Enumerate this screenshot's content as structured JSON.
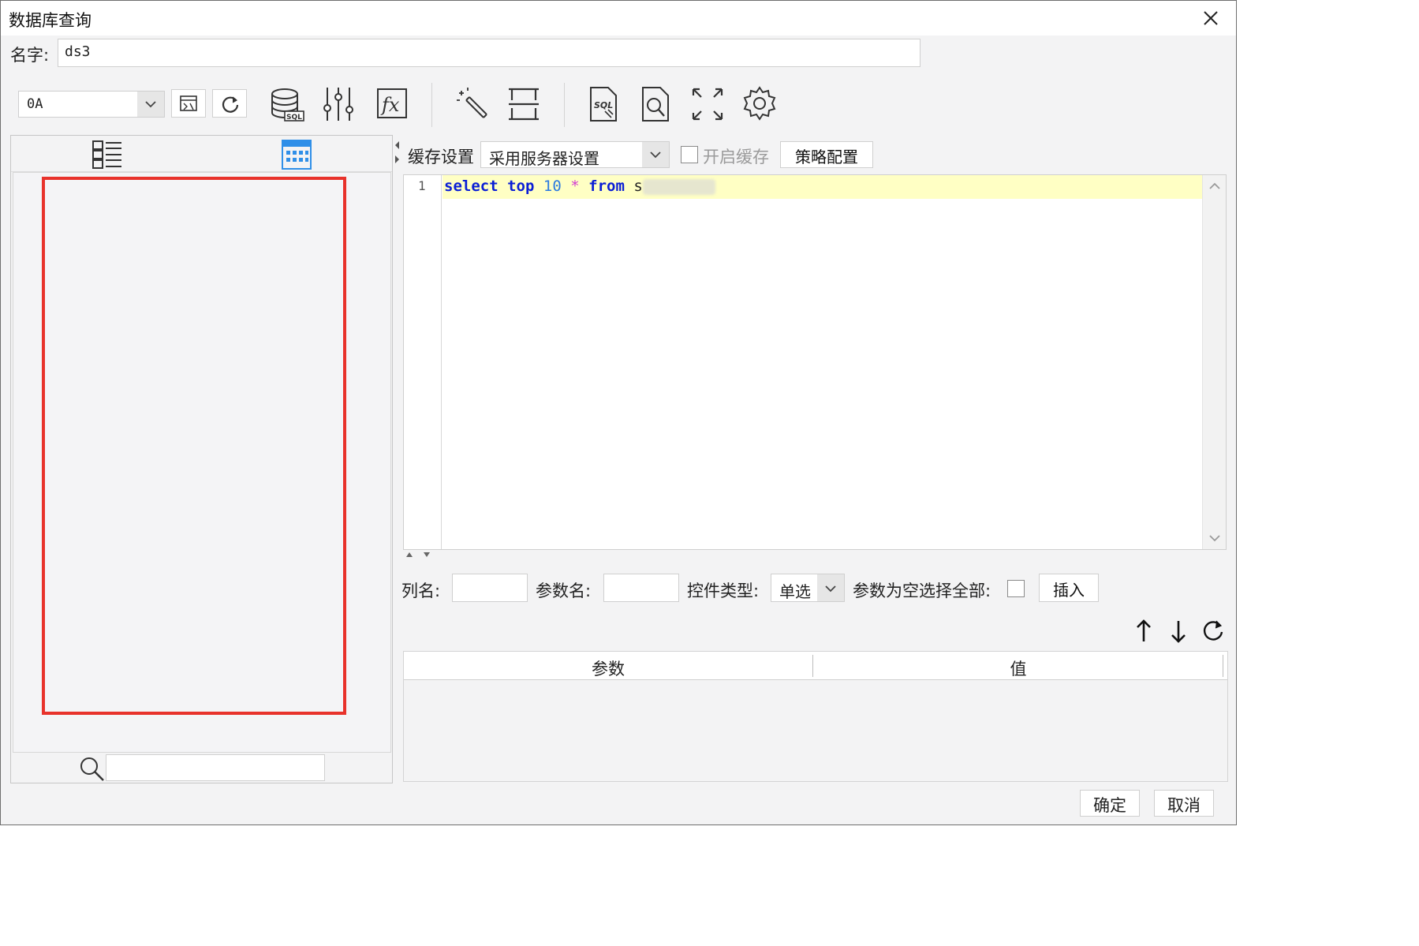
{
  "window": {
    "title": "数据库查询",
    "close_icon": "close-icon"
  },
  "name_row": {
    "label": "名字:",
    "value": "ds3"
  },
  "toolbar": {
    "datasource": "0A",
    "icons": [
      "preview-icon",
      "refresh-icon",
      "database-sql-icon",
      "parameter-sliders-icon",
      "formula-icon",
      "magic-wand-icon",
      "layout-icon",
      "sql-document-icon",
      "search-document-icon",
      "expand-icon",
      "settings-icon"
    ]
  },
  "left_panel": {
    "tabs": [
      "list-view-icon",
      "grid-view-icon"
    ],
    "highlight_color": "#e8322b",
    "search_placeholder": ""
  },
  "cache": {
    "label": "缓存设置",
    "mode": "采用服务器设置",
    "enable_label": "开启缓存",
    "enable_checked": false,
    "strategy_button": "策略配置"
  },
  "editor": {
    "line_number": "1",
    "kw_select": "select",
    "kw_top": "top",
    "num": "10",
    "star": "*",
    "kw_from": "from",
    "table_prefix": "s"
  },
  "param_row": {
    "col_label": "列名:",
    "param_label": "参数名:",
    "type_label": "控件类型:",
    "type_value": "单选",
    "empty_all_label": "参数为空选择全部:",
    "empty_all_checked": false,
    "insert_button": "插入"
  },
  "param_table": {
    "headers": [
      "参数",
      "值"
    ],
    "rows": []
  },
  "footer": {
    "ok": "确定",
    "cancel": "取消"
  },
  "colors": {
    "keyword": "#0a1ed6",
    "number": "#2b7ae0",
    "operator": "#d23ad2",
    "line_highlight": "#ffffc4",
    "accent": "#2f8fe8"
  }
}
